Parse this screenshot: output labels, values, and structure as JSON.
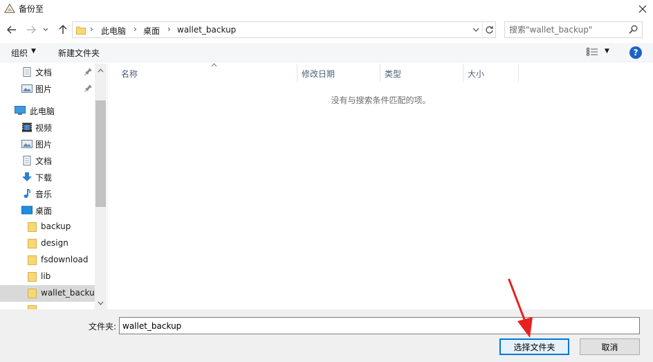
{
  "window": {
    "title": "备份至",
    "icon": "warning-triangle-icon"
  },
  "address": {
    "crumbs": [
      "此电脑",
      "桌面",
      "wallet_backup"
    ],
    "search_placeholder": "搜索\"wallet_backup\""
  },
  "toolbar": {
    "organize_label": "组织",
    "new_folder_label": "新建文件夹"
  },
  "nav": {
    "items": [
      {
        "label": "文档",
        "icon": "documents-icon",
        "pinned": true
      },
      {
        "label": "图片",
        "icon": "pictures-icon",
        "pinned": true
      },
      {
        "label": "此电脑",
        "icon": "computer-icon"
      },
      {
        "label": "视频",
        "icon": "videos-icon"
      },
      {
        "label": "图片",
        "icon": "pictures-icon"
      },
      {
        "label": "文档",
        "icon": "documents-icon"
      },
      {
        "label": "下载",
        "icon": "downloads-icon"
      },
      {
        "label": "音乐",
        "icon": "music-icon"
      },
      {
        "label": "桌面",
        "icon": "desktop-icon"
      },
      {
        "label": "backup",
        "icon": "folder-icon"
      },
      {
        "label": "design",
        "icon": "folder-icon"
      },
      {
        "label": "fsdownload",
        "icon": "folder-icon"
      },
      {
        "label": "lib",
        "icon": "folder-icon"
      },
      {
        "label": "wallet_backup",
        "icon": "folder-icon",
        "selected": true
      }
    ]
  },
  "list": {
    "columns": [
      "名称",
      "修改日期",
      "类型",
      "大小"
    ],
    "empty_message": "没有与搜索条件匹配的项。"
  },
  "footer": {
    "folder_label": "文件夹:",
    "folder_value": "wallet_backup",
    "select_button": "选择文件夹",
    "cancel_button": "取消"
  },
  "colors": {
    "accent": "#0078d7",
    "annotation_arrow": "#e8201f",
    "help_blue": "#1a64c8",
    "folder_yellow": "#f8d775"
  }
}
